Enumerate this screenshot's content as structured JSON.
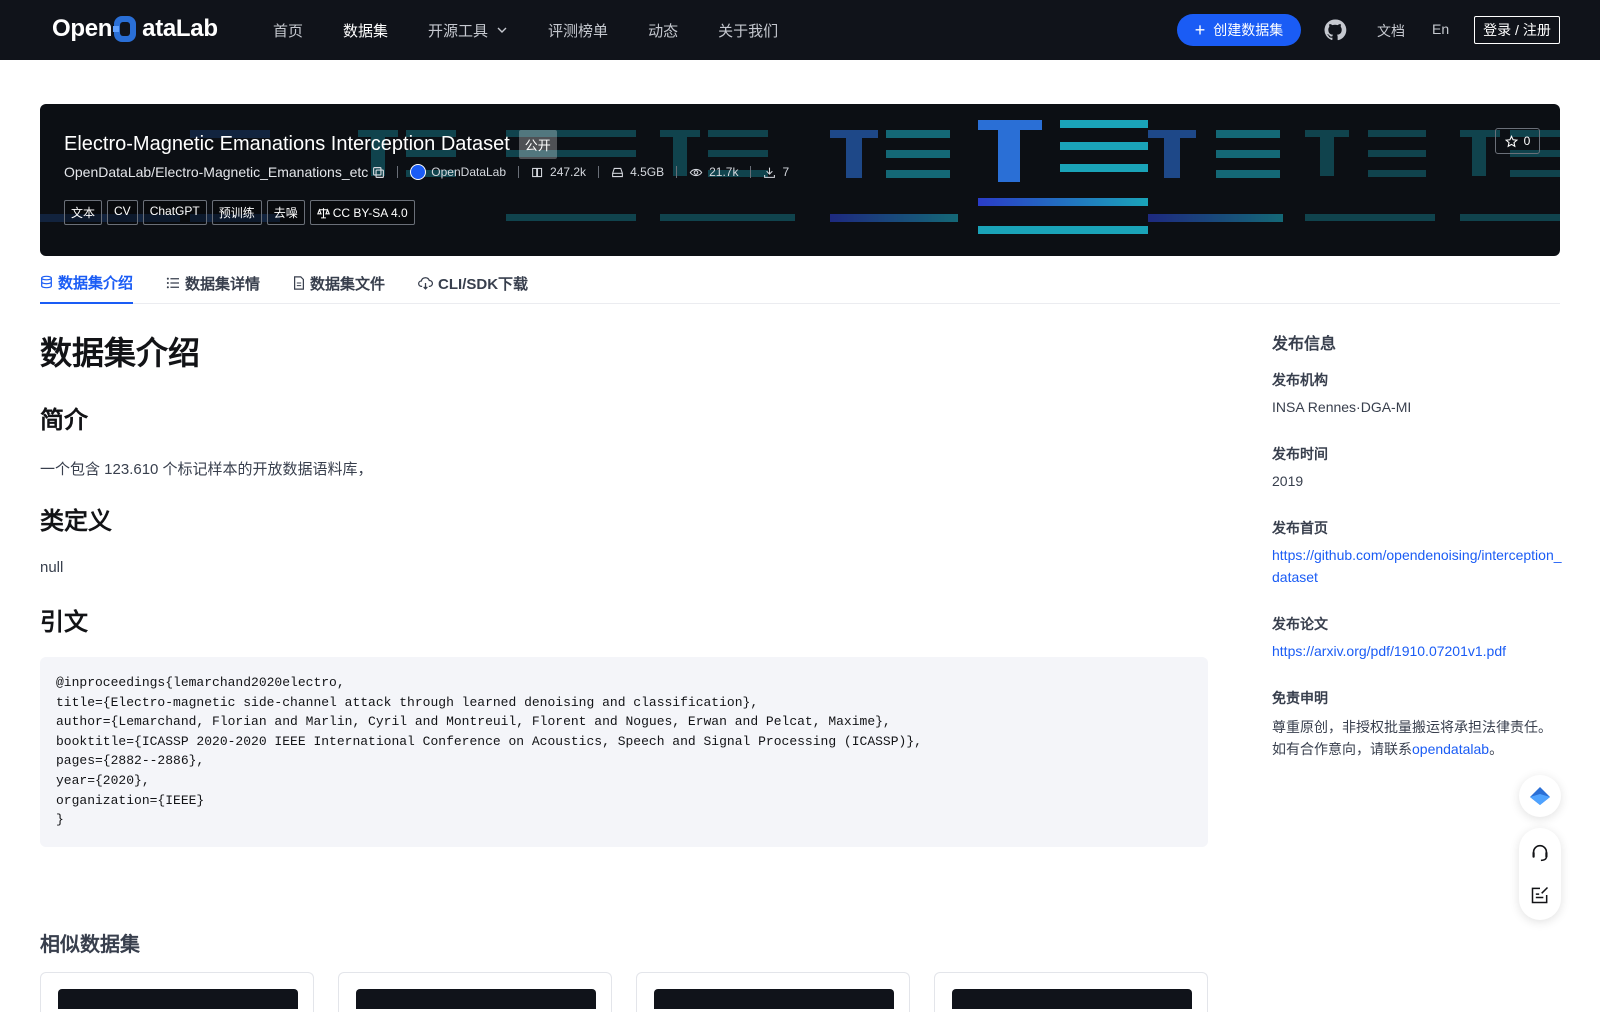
{
  "nav": {
    "brand": "OpenDataLab",
    "brand_left": "Open",
    "brand_right": "ataLab",
    "links": [
      {
        "label": "首页"
      },
      {
        "label": "数据集"
      },
      {
        "label": "开源工具"
      },
      {
        "label": "评测榜单"
      },
      {
        "label": "动态"
      },
      {
        "label": "关于我们"
      }
    ],
    "active_link": "数据集",
    "create_button": "创建数据集",
    "docs": "文档",
    "lang": "En",
    "login": "登录 / 注册"
  },
  "dataset": {
    "title": "Electro-Magnetic Emanations Interception Dataset",
    "visibility": "公开",
    "path": "OpenDataLab/Electro-Magnetic_Emanations_etc",
    "org": "OpenDataLab",
    "file_count": "247.2k",
    "size": "4.5GB",
    "views": "21.7k",
    "downloads": "7",
    "stars": "0",
    "tags": [
      "文本",
      "CV",
      "ChatGPT",
      "预训练",
      "去噪"
    ],
    "license": "CC BY-SA 4.0"
  },
  "tabs": [
    {
      "label": "数据集介绍",
      "icon": "database-icon"
    },
    {
      "label": "数据集详情",
      "icon": "list-icon"
    },
    {
      "label": "数据集文件",
      "icon": "file-icon"
    },
    {
      "label": "CLI/SDK下载",
      "icon": "cloud-download-icon"
    }
  ],
  "content": {
    "heading": "数据集介绍",
    "intro_heading": "简介",
    "intro_text": "一个包含 123.610 个标记样本的开放数据语料库，",
    "classes_heading": "类定义",
    "classes_text": "null",
    "citation_heading": "引文",
    "citation": "@inproceedings{lemarchand2020electro,\ntitle={Electro-magnetic side-channel attack through learned denoising and classification},\nauthor={Lemarchand, Florian and Marlin, Cyril and Montreuil, Florent and Nogues, Erwan and Pelcat, Maxime},\nbooktitle={ICASSP 2020-2020 IEEE International Conference on Acoustics, Speech and Signal Processing (ICASSP)},\npages={2882--2886},\nyear={2020},\norganization={IEEE}\n}",
    "similar_heading": "相似数据集"
  },
  "sidebar": {
    "title": "发布信息",
    "org_label": "发布机构",
    "org_value": "INSA Rennes·DGA-MI",
    "time_label": "发布时间",
    "time_value": "2019",
    "home_label": "发布首页",
    "home_value": "https://github.com/opendenoising/interception_dataset",
    "paper_label": "发布论文",
    "paper_value": "https://arxiv.org/pdf/1910.07201v1.pdf",
    "disclaimer_label": "免责申明",
    "disclaimer_line1": "尊重原创，非授权批量搬运将承担法律责任。",
    "disclaimer_line2_prefix": "如有合作意向，请联系",
    "disclaimer_link": "opendatalab",
    "disclaimer_suffix": "。"
  },
  "colors": {
    "accent": "#1a5cf5",
    "nav_bg": "#10131a",
    "banner_bg": "#0c0f14",
    "banner_teal": "#1aa3b8",
    "banner_blue": "#2a6fd6"
  }
}
